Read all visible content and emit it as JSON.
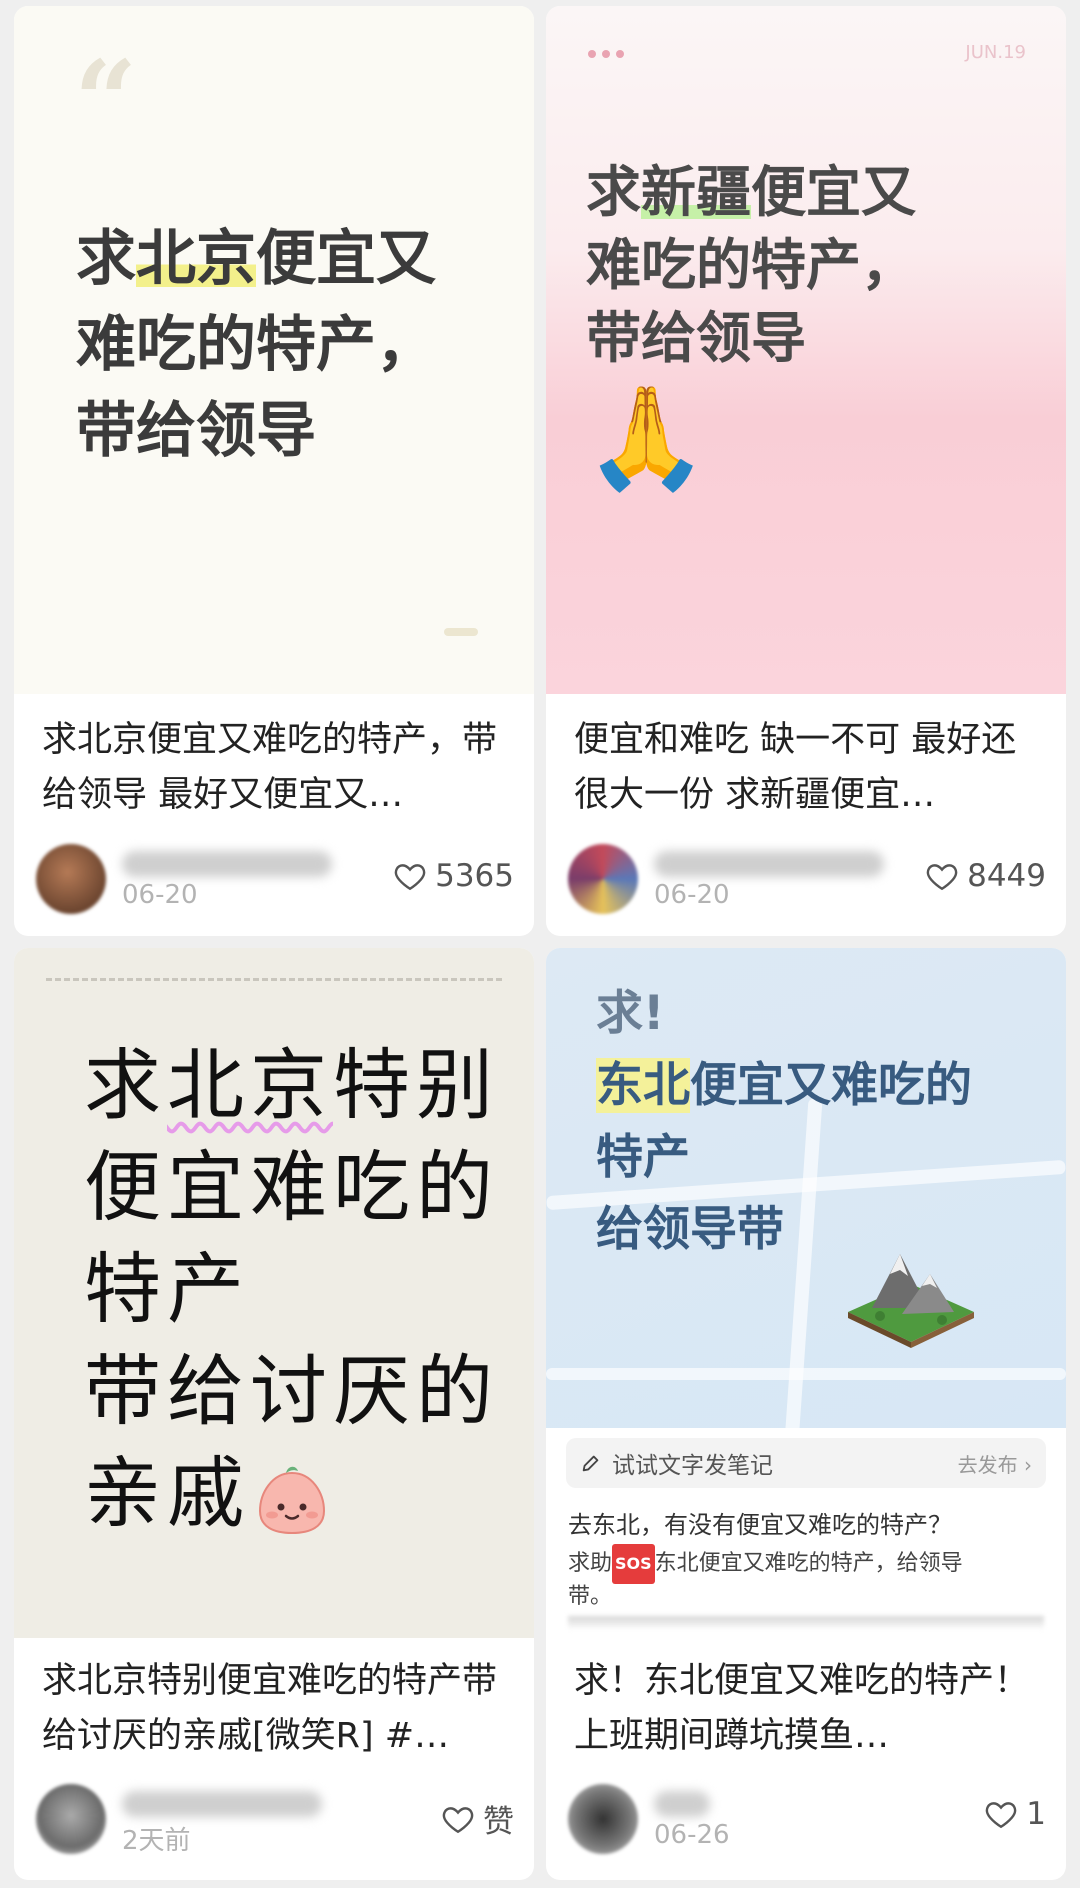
{
  "cards": [
    {
      "cover": {
        "quote": "“",
        "title_pre": "求",
        "title_highlight": "北京",
        "title_post": "便宜又",
        "line2": "难吃的特产，",
        "line3": "带给领导"
      },
      "caption": "求北京便宜又难吃的特产，带给领导 最好又便宜又…",
      "date": "06-20",
      "likes": "5365"
    },
    {
      "cover": {
        "tag": "JUN.19",
        "title_pre": "求",
        "title_highlight": "新疆",
        "title_post": "便宜又",
        "line2": "难吃的特产，",
        "line3": "带给领导",
        "emoji": "🙏"
      },
      "caption": "便宜和难吃 缺一不可 最好还很大一份 求新疆便宜…",
      "date": "06-20",
      "likes": "8449"
    },
    {
      "cover": {
        "title_pre": "求",
        "title_highlight": "北京",
        "title_post": "特别",
        "line2": "便宜难吃的",
        "line3": "特产",
        "line4": "带给讨厌的",
        "line5": "亲戚"
      },
      "caption": "求北京特别便宜难吃的特产带给讨厌的亲戚[微笑R] #…",
      "date": "2天前",
      "likes": "赞"
    },
    {
      "cover": {
        "top": "求!",
        "title_highlight": "东北",
        "title_post": "便宜又难吃的",
        "line2": "特产",
        "line3": "给领导带"
      },
      "tip": {
        "label": "试试文字发笔记",
        "action": "去发布 ›"
      },
      "preview": {
        "line1": "去东北，有没有便宜又难吃的特产？",
        "line2_pre": "求助",
        "sos": "SOS",
        "line2_post": "东北便宜又难吃的特产，给领导",
        "line3": "带。"
      },
      "caption": "求！东北便宜又难吃的特产！ 上班期间蹲坑摸鱼…",
      "date": "06-26",
      "likes": "1"
    }
  ],
  "colors": {
    "highlight_yellow": "#f3f08b",
    "highlight_green": "#c6f0a8",
    "wavy_underline": "#e69be9",
    "card4_title": "#385b80"
  }
}
